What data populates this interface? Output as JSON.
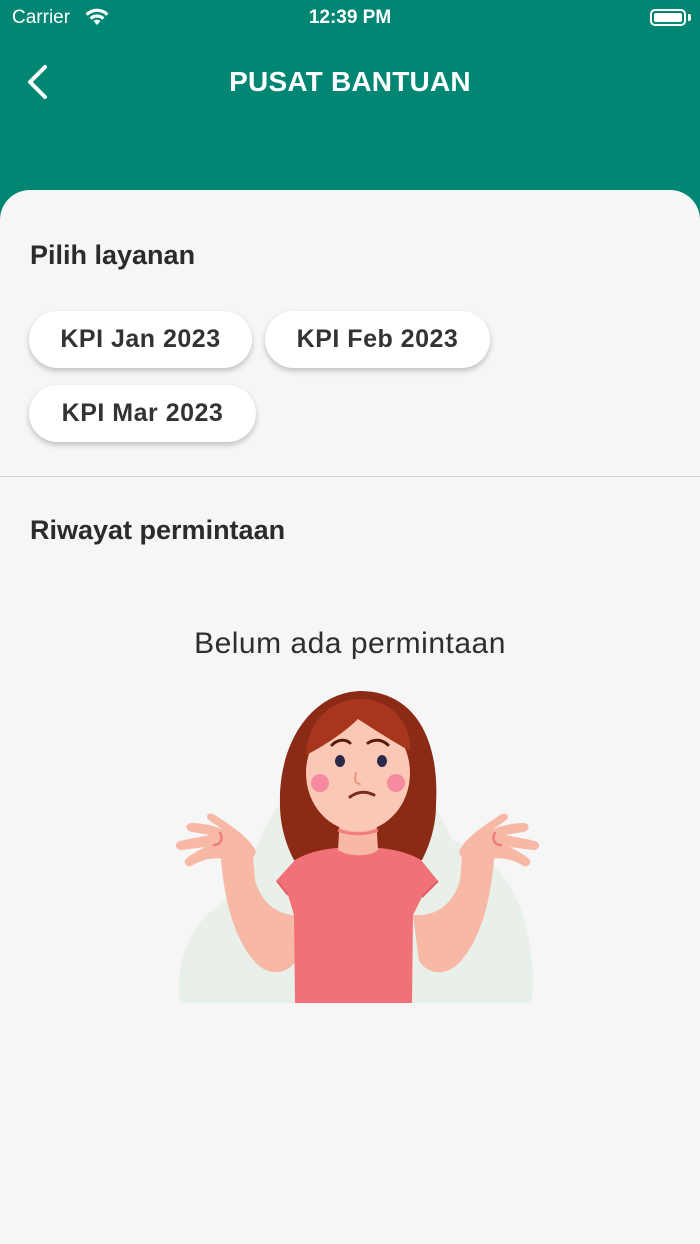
{
  "status_bar": {
    "carrier": "Carrier",
    "time": "12:39 PM",
    "wifi_icon": "wifi-icon",
    "battery_icon": "battery-icon"
  },
  "nav": {
    "title": "PUSAT BANTUAN",
    "back_icon": "chevron-left-icon"
  },
  "services": {
    "title": "Pilih layanan",
    "items": [
      {
        "label": "KPI Jan 2023"
      },
      {
        "label": "KPI Feb 2023"
      },
      {
        "label": "KPI Mar 2023"
      }
    ]
  },
  "history": {
    "title": "Riwayat permintaan",
    "empty_text": "Belum ada permintaan",
    "empty_illustration": "shrugging-woman-illustration"
  },
  "colors": {
    "header": "#008673",
    "background": "#f6f6f6",
    "chip": "#ffffff"
  }
}
